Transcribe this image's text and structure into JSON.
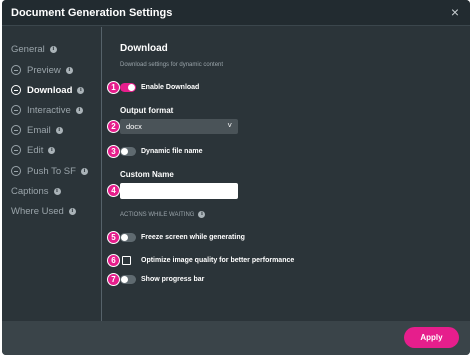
{
  "dialog": {
    "title": "Document Generation Settings",
    "close_glyph": "×"
  },
  "sidebar": {
    "items": [
      {
        "label": "General",
        "has_info": true,
        "has_minus": false,
        "active": false
      },
      {
        "label": "Preview",
        "has_info": true,
        "has_minus": true,
        "active": false
      },
      {
        "label": "Download",
        "has_info": true,
        "has_minus": true,
        "active": true
      },
      {
        "label": "Interactive",
        "has_info": true,
        "has_minus": true,
        "active": false
      },
      {
        "label": "Email",
        "has_info": true,
        "has_minus": true,
        "active": false
      },
      {
        "label": "Edit",
        "has_info": true,
        "has_minus": true,
        "active": false
      },
      {
        "label": "Push To SF",
        "has_info": true,
        "has_minus": true,
        "active": false
      },
      {
        "label": "Captions",
        "has_info": true,
        "has_minus": false,
        "active": false
      },
      {
        "label": "Where Used",
        "has_info": true,
        "has_minus": false,
        "active": false
      }
    ],
    "info_glyph": "i"
  },
  "content": {
    "heading": "Download",
    "subheading": "Download settings for dynamic content",
    "enable_download": {
      "badge": "1",
      "label": "Enable Download",
      "on": true
    },
    "output_format": {
      "badge": "2",
      "label": "Output format",
      "value": "docx",
      "chevron": "˅"
    },
    "dynamic_file_name": {
      "badge": "3",
      "label": "Dynamic file name",
      "on": false
    },
    "custom_name": {
      "badge": "4",
      "label": "Custom Name",
      "value": "",
      "placeholder": ""
    },
    "actions_section": "ACTIONS WHILE WAITING",
    "freeze_screen": {
      "badge": "5",
      "label": "Freeze screen while generating",
      "on": false
    },
    "optimize_image": {
      "badge": "6",
      "label": "Optimize image quality for better performance",
      "checked": false
    },
    "show_progress": {
      "badge": "7",
      "label": "Show progress bar",
      "on": false
    }
  },
  "footer": {
    "apply_label": "Apply"
  },
  "colors": {
    "accent": "#e61e8c",
    "dialog_bg": "#2b3439",
    "footer_bg": "#3a4449"
  }
}
